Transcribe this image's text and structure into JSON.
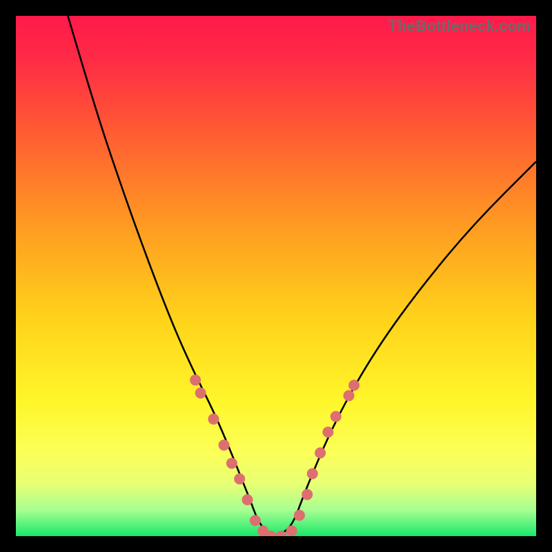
{
  "watermark": "TheBottleneck.com",
  "chart_data": {
    "type": "line",
    "title": "",
    "xlabel": "",
    "ylabel": "",
    "xlim": [
      0,
      100
    ],
    "ylim": [
      0,
      100
    ],
    "grid": false,
    "legend": false,
    "background_gradient": {
      "top_color": "#ff1a4b",
      "mid_colors": [
        "#ff6a2a",
        "#ffd21a",
        "#fff62a"
      ],
      "bottom_color": "#17e86a"
    },
    "series": [
      {
        "name": "bottleneck-curve",
        "color": "#000000",
        "x": [
          10,
          15,
          20,
          25,
          30,
          34,
          38,
          41,
          43,
          45,
          46.5,
          48,
          50,
          52,
          53.5,
          55,
          57,
          60,
          64,
          70,
          78,
          88,
          100
        ],
        "y": [
          100,
          83,
          68,
          54,
          41,
          32,
          24,
          17,
          12,
          7,
          3,
          1,
          0,
          1,
          3,
          7,
          12,
          19,
          27,
          37,
          48,
          60,
          72
        ]
      }
    ],
    "markers": {
      "name": "sample-points",
      "color": "#dd6f70",
      "radius": 8,
      "x": [
        34.5,
        35.5,
        38,
        40,
        41.5,
        43,
        44.5,
        46,
        47.5,
        49,
        51,
        53,
        54.5,
        56,
        57,
        58.5,
        60,
        61.5,
        64,
        65
      ],
      "y": [
        30,
        27.5,
        22.5,
        17.5,
        14,
        11,
        7,
        3,
        1,
        0,
        0,
        1,
        4,
        8,
        12,
        16,
        20,
        23,
        27,
        29
      ]
    }
  }
}
